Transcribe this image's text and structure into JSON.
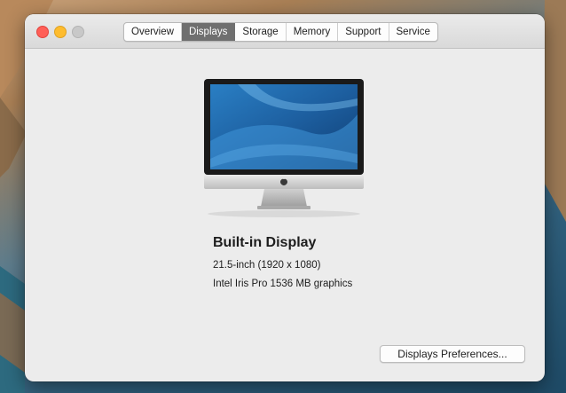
{
  "window": {
    "tabs": [
      {
        "label": "Overview",
        "active": false
      },
      {
        "label": "Displays",
        "active": true
      },
      {
        "label": "Storage",
        "active": false
      },
      {
        "label": "Memory",
        "active": false
      },
      {
        "label": "Support",
        "active": false
      },
      {
        "label": "Service",
        "active": false
      }
    ]
  },
  "display": {
    "name": "Built-in Display",
    "size": "21.5-inch (1920 x 1080)",
    "graphics": "Intel Iris Pro 1536 MB graphics",
    "icon": "imac-icon"
  },
  "actions": {
    "preferences_label": "Displays Preferences..."
  },
  "colors": {
    "active_tab": "#6f6f6f",
    "close": "#ff5f57",
    "minimize": "#febc2e",
    "zoom_disabled": "#c8c8c8"
  }
}
